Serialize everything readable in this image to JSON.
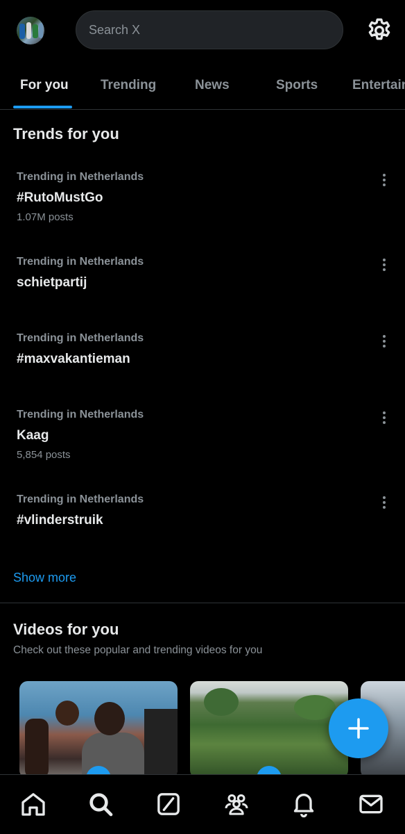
{
  "header": {
    "search_placeholder": "Search X"
  },
  "tabs": [
    {
      "label": "For you",
      "active": true
    },
    {
      "label": "Trending",
      "active": false
    },
    {
      "label": "News",
      "active": false
    },
    {
      "label": "Sports",
      "active": false
    },
    {
      "label": "Entertainment",
      "active": false
    }
  ],
  "trends": {
    "title": "Trends for you",
    "items": [
      {
        "meta": "Trending in Netherlands",
        "name": "#RutoMustGo",
        "count": "1.07M posts"
      },
      {
        "meta": "Trending in Netherlands",
        "name": "schietpartij",
        "count": ""
      },
      {
        "meta": "Trending in Netherlands",
        "name": "#maxvakantieman",
        "count": ""
      },
      {
        "meta": "Trending in Netherlands",
        "name": "Kaag",
        "count": "5,854 posts"
      },
      {
        "meta": "Trending in Netherlands",
        "name": "#vlinderstruik",
        "count": ""
      }
    ],
    "show_more": "Show more"
  },
  "videos": {
    "title": "Videos for you",
    "subtitle": "Check out these popular and trending videos for you"
  },
  "icons": {
    "settings": "gear-icon",
    "more": "more-vertical-icon",
    "compose": "plus-icon",
    "nav": [
      "home-icon",
      "search-icon",
      "grok-icon",
      "communities-icon",
      "notifications-icon",
      "messages-icon"
    ]
  },
  "colors": {
    "background": "#000000",
    "accent": "#1d9bf0",
    "primary_text": "#e7e9ea",
    "secondary_text": "#8b9298"
  }
}
